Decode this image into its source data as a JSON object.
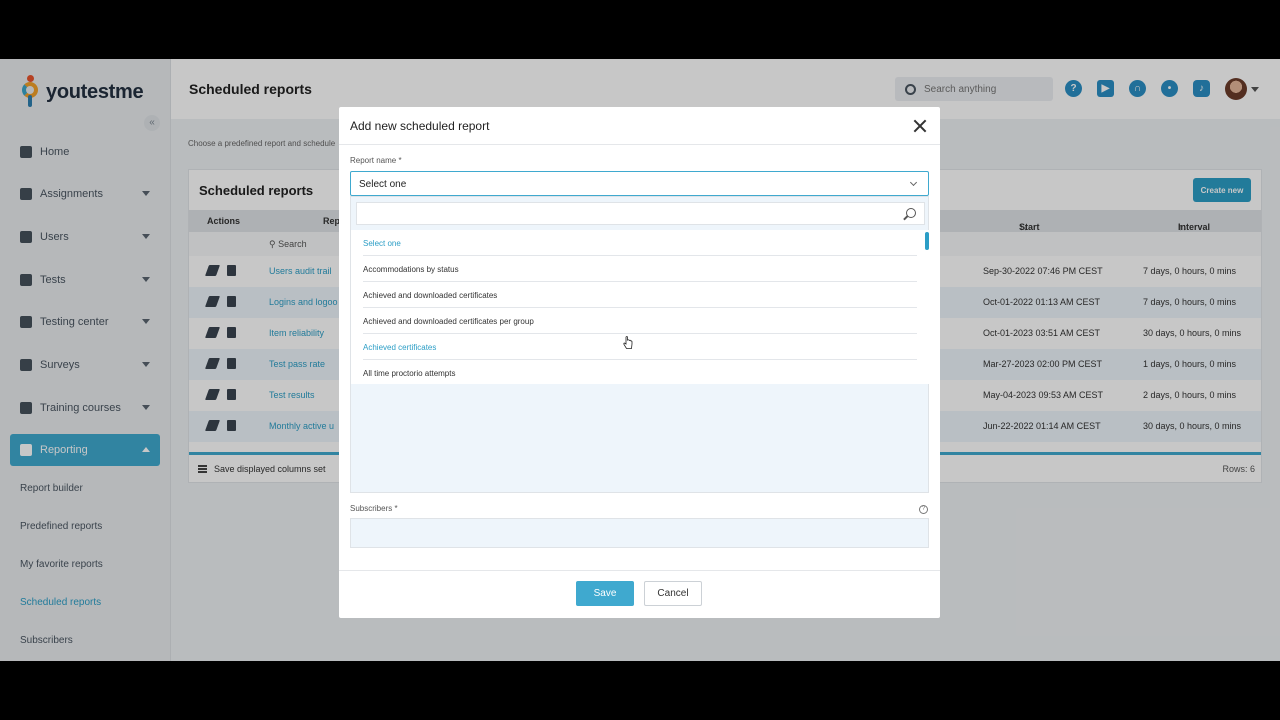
{
  "brand": {
    "name": "youtestme"
  },
  "sidebar": {
    "items": [
      {
        "label": "Home"
      },
      {
        "label": "Assignments"
      },
      {
        "label": "Users"
      },
      {
        "label": "Tests"
      },
      {
        "label": "Testing center"
      },
      {
        "label": "Surveys"
      },
      {
        "label": "Training courses"
      },
      {
        "label": "Reporting"
      }
    ],
    "sub_items": [
      {
        "label": "Report builder"
      },
      {
        "label": "Predefined reports"
      },
      {
        "label": "My favorite reports"
      },
      {
        "label": "Scheduled reports"
      },
      {
        "label": "Subscribers"
      }
    ]
  },
  "header": {
    "title": "Scheduled reports",
    "search_placeholder": "Search anything"
  },
  "main": {
    "intro": "Choose a predefined report and schedule",
    "card_title": "Scheduled reports",
    "create_label": "Create new",
    "columns": {
      "actions": "Actions",
      "report": "Repo",
      "start": "Start time",
      "interval": "Interval"
    },
    "sort_icon": "↑↓",
    "filter_placeholder": "Search",
    "rows": [
      {
        "name": "Users audit trail",
        "start": "Sep-30-2022 07:46 PM CEST",
        "interval": "7 days, 0 hours, 0 mins"
      },
      {
        "name": "Logins and logoo",
        "start": "Oct-01-2022 01:13 AM CEST",
        "interval": "7 days, 0 hours, 0 mins"
      },
      {
        "name": "Item reliability",
        "start": "Oct-01-2023 03:51 AM CEST",
        "interval": "30 days, 0 hours, 0 mins"
      },
      {
        "name": "Test pass rate",
        "start": "Mar-27-2023 02:00 PM CEST",
        "interval": "1 days, 0 hours, 0 mins"
      },
      {
        "name": "Test results",
        "start": "May-04-2023 09:53 AM CEST",
        "interval": "2 days, 0 hours, 0 mins"
      },
      {
        "name": "Monthly active u",
        "start": "Jun-22-2022 01:14 AM CEST",
        "interval": "30 days, 0 hours, 0 mins"
      }
    ],
    "footer_save": "Save displayed columns set",
    "rows_count": "Rows: 6"
  },
  "modal": {
    "title": "Add new scheduled report",
    "report_name_label": "Report name",
    "required_mark": "*",
    "selected_value": "Select one",
    "options": [
      "Select one",
      "Accommodations by status",
      "Achieved and downloaded certificates",
      "Achieved and downloaded certificates per group",
      "Achieved certificates",
      "All time proctorio attempts"
    ],
    "subscribers_label": "Subscribers",
    "info_glyph": "?",
    "save_label": "Save",
    "cancel_label": "Cancel"
  },
  "colors": {
    "accent": "#3fa9cf",
    "link": "#2c9ec6"
  }
}
